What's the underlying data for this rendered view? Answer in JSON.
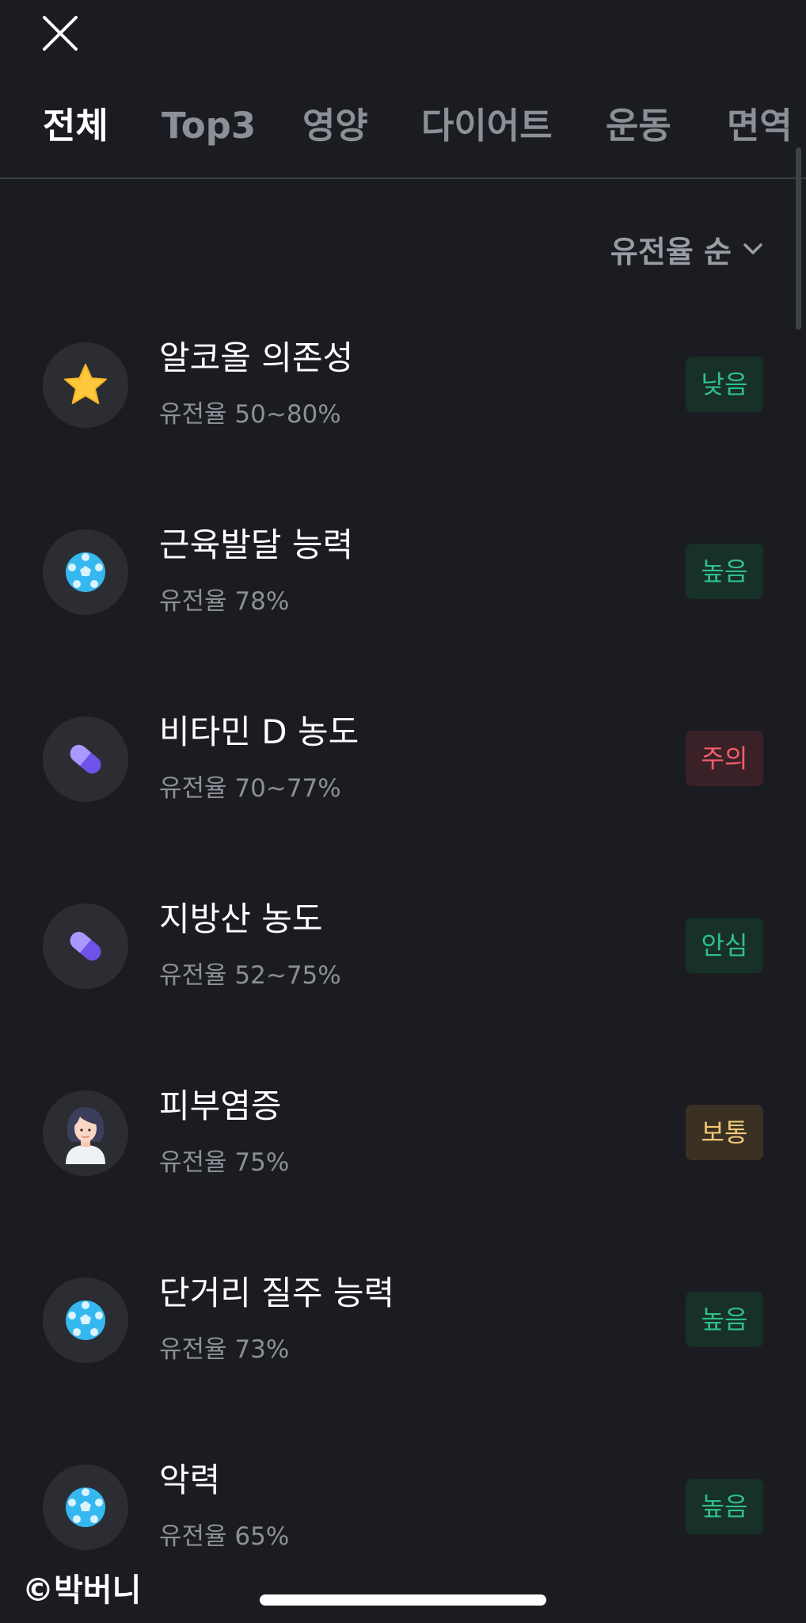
{
  "header": {
    "close_icon": "close-icon"
  },
  "tabs": [
    {
      "label": "전체",
      "active": true
    },
    {
      "label": "Top3",
      "active": false
    },
    {
      "label": "영양",
      "active": false
    },
    {
      "label": "다이어트",
      "active": false
    },
    {
      "label": "운동",
      "active": false
    },
    {
      "label": "면역",
      "active": false
    }
  ],
  "sort": {
    "label": "유전율 순",
    "icon": "chevron-down-icon"
  },
  "items": [
    {
      "title": "알코올 의존성",
      "subtitle": "유전율 50~80%",
      "badge": "낮음",
      "badge_color": "#2fc08a",
      "icon": "star-icon"
    },
    {
      "title": "근육발달 능력",
      "subtitle": "유전율 78%",
      "badge": "높음",
      "badge_color": "#2fc08a",
      "icon": "soccer-ball-icon"
    },
    {
      "title": "비타민 D 농도",
      "subtitle": "유전율 70~77%",
      "badge": "주의",
      "badge_color": "#f25e6b",
      "icon": "pill-icon"
    },
    {
      "title": "지방산 농도",
      "subtitle": "유전율 52~75%",
      "badge": "안심",
      "badge_color": "#2fc08a",
      "icon": "pill-icon"
    },
    {
      "title": "피부염증",
      "subtitle": "유전율 75%",
      "badge": "보통",
      "badge_color": "#f2c877",
      "icon": "woman-face-icon"
    },
    {
      "title": "단거리 질주 능력",
      "subtitle": "유전율 73%",
      "badge": "높음",
      "badge_color": "#2fc08a",
      "icon": "soccer-ball-icon"
    },
    {
      "title": "악력",
      "subtitle": "유전율 65%",
      "badge": "높음",
      "badge_color": "#2fc08a",
      "icon": "soccer-ball-icon"
    }
  ],
  "watermark": "©박버니"
}
